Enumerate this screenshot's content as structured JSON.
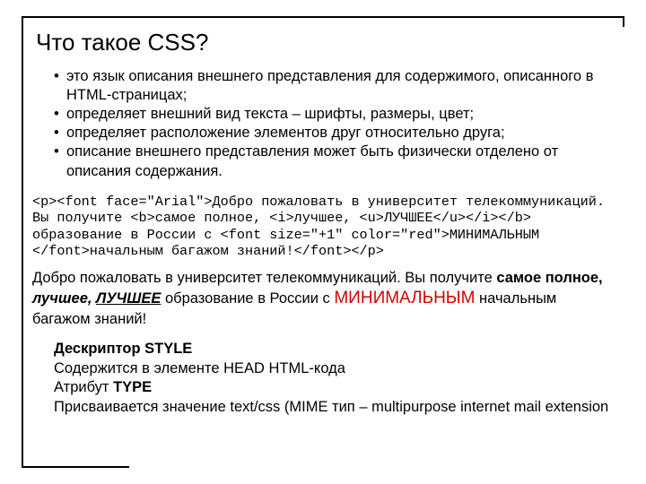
{
  "title": "Что такое CSS?",
  "bullets": [
    "это язык описания внешнего представления для содержимого, описанного в HTML-страницах;",
    "определяет внешний вид текста – шрифты, размеры, цвет;",
    "определяет расположение элементов друг относительно друга;",
    "описание внешнего представления может быть физически отделено от описания содержания."
  ],
  "code_lines": [
    "<p><font face=\"Arial\">Добро пожаловать в университет телекоммуникаций.",
    "Вы получите <b>самое полное, <i>лучшее, <u>ЛУЧШЕЕ</u></i></b>",
    "образование в России с <font size=\"+1\" color=\"red\">МИНИМАЛЬНЫМ",
    "</font>начальным багажом знаний!</font></p>"
  ],
  "rendered": {
    "t1": "Добро пожаловать в университет телекоммуникаций. Вы получите ",
    "t2_bold": "самое полное, ",
    "t3_bi": "лучшее, ",
    "t4_biu": "ЛУЧШЕЕ",
    "t5": " образование в России с ",
    "t6_red": "МИНИМАЛЬНЫМ",
    "t7": " начальным багажом знаний!"
  },
  "desc": {
    "h1": "Дескриптор STYLE",
    "l1": "Содержится в элементе HEAD HTML-кода",
    "l2a": "Атрибут ",
    "l2b": "TYPE",
    "l3": "Присваивается значение text/css (MIME тип – multipurpose internet mail extension"
  }
}
